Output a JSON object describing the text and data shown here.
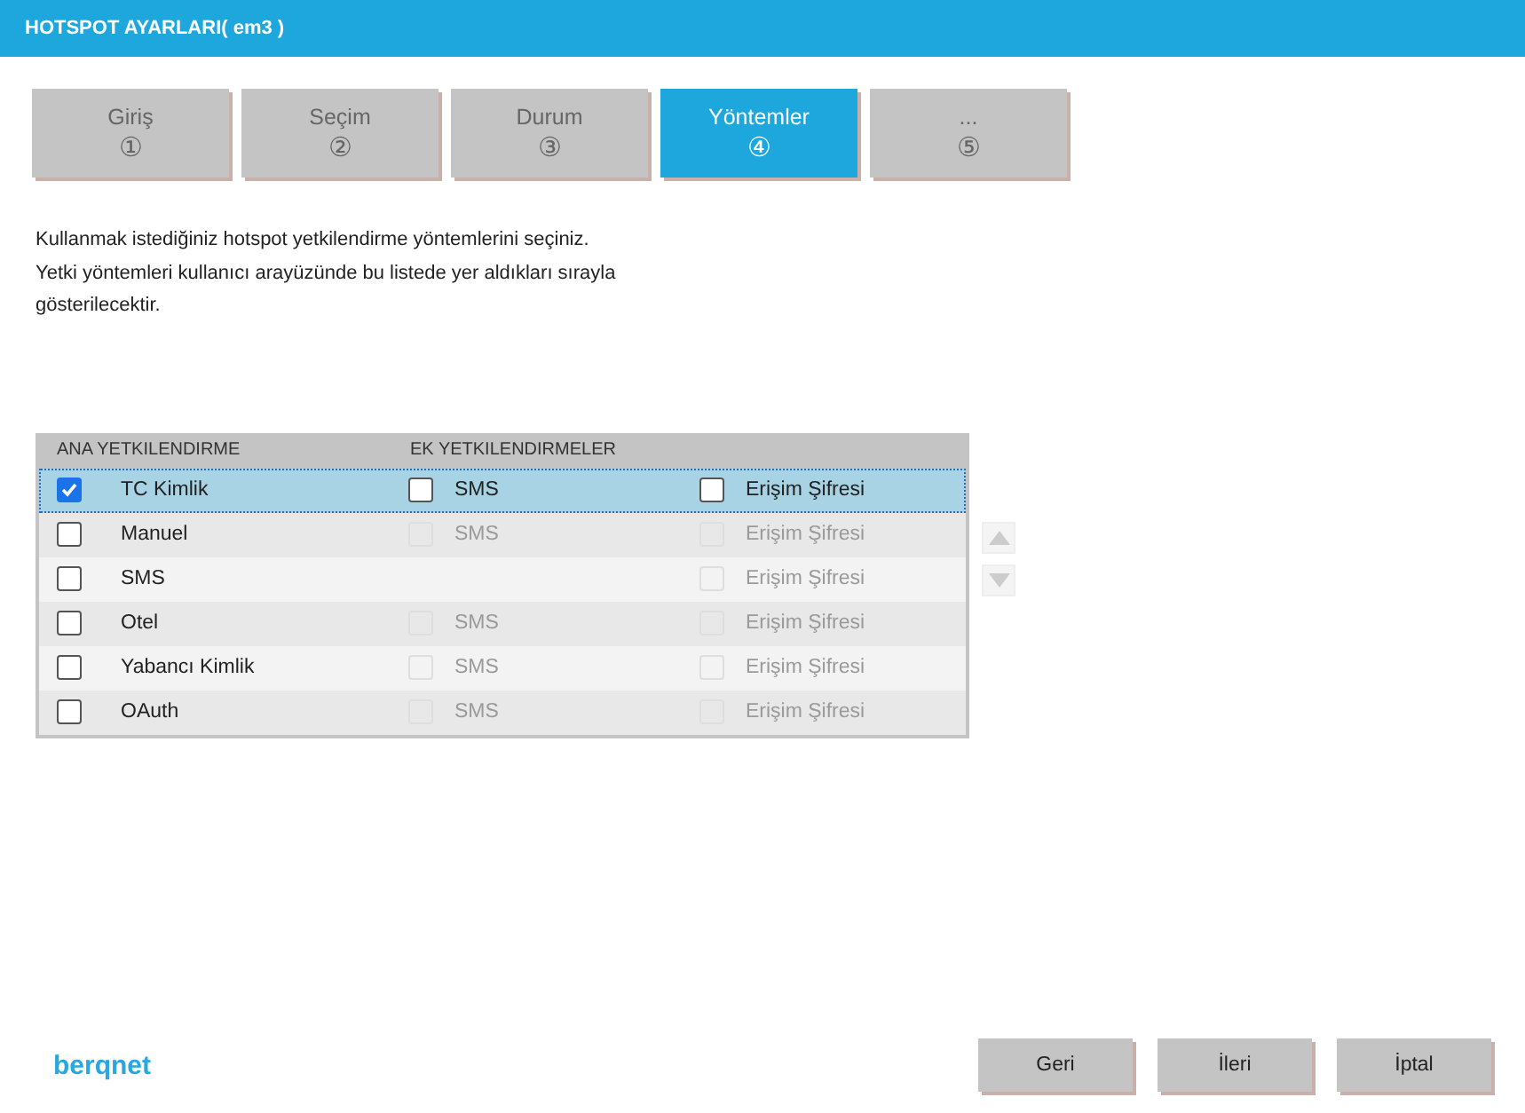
{
  "window": {
    "title": "HOTSPOT AYARLARI( em3 )"
  },
  "steps": [
    {
      "label": "Giriş",
      "number": "①",
      "selected": false
    },
    {
      "label": "Seçim",
      "number": "②",
      "selected": false
    },
    {
      "label": "Durum",
      "number": "③",
      "selected": false
    },
    {
      "label": "Yöntemler",
      "number": "④",
      "selected": true
    },
    {
      "label": "...",
      "number": "⑤",
      "selected": false
    }
  ],
  "description": [
    "Kullanmak istediğiniz hotspot yetkilendirme yöntemlerini seçiniz.",
    "Yetki yöntemleri kullanıcı arayüzünde bu listede yer aldıkları sırayla",
    "gösterilecektir."
  ],
  "table": {
    "columns": [
      "ANA YETKILENDIRME",
      "EK YETKILENDIRMELER"
    ],
    "rows": [
      {
        "name": "TC Kimlik",
        "checked": true,
        "selected": true,
        "extras": [
          {
            "kind": "sms",
            "label": "SMS",
            "checked": false,
            "disabled": false
          },
          {
            "kind": "password",
            "label": "Erişim Şifresi",
            "checked": false,
            "disabled": false
          }
        ]
      },
      {
        "name": "Manuel",
        "checked": false,
        "selected": false,
        "extras": [
          {
            "kind": "sms",
            "label": "SMS",
            "checked": false,
            "disabled": true
          },
          {
            "kind": "password",
            "label": "Erişim Şifresi",
            "checked": false,
            "disabled": true
          }
        ]
      },
      {
        "name": "SMS",
        "checked": false,
        "selected": false,
        "extras": [
          {
            "kind": "password",
            "label": "Erişim Şifresi",
            "checked": false,
            "disabled": true
          }
        ]
      },
      {
        "name": "Otel",
        "checked": false,
        "selected": false,
        "extras": [
          {
            "kind": "sms",
            "label": "SMS",
            "checked": false,
            "disabled": true
          },
          {
            "kind": "password",
            "label": "Erişim Şifresi",
            "checked": false,
            "disabled": true
          }
        ]
      },
      {
        "name": "Yabancı Kimlik",
        "checked": false,
        "selected": false,
        "extras": [
          {
            "kind": "sms",
            "label": "SMS",
            "checked": false,
            "disabled": true
          },
          {
            "kind": "password",
            "label": "Erişim Şifresi",
            "checked": false,
            "disabled": true
          }
        ]
      },
      {
        "name": "OAuth",
        "checked": false,
        "selected": false,
        "extras": [
          {
            "kind": "sms",
            "label": "SMS",
            "checked": false,
            "disabled": true
          },
          {
            "kind": "password",
            "label": "Erişim Şifresi",
            "checked": false,
            "disabled": true
          }
        ]
      }
    ]
  },
  "logo": "berqnet",
  "buttons": [
    "Geri",
    "İleri",
    "İptal"
  ]
}
